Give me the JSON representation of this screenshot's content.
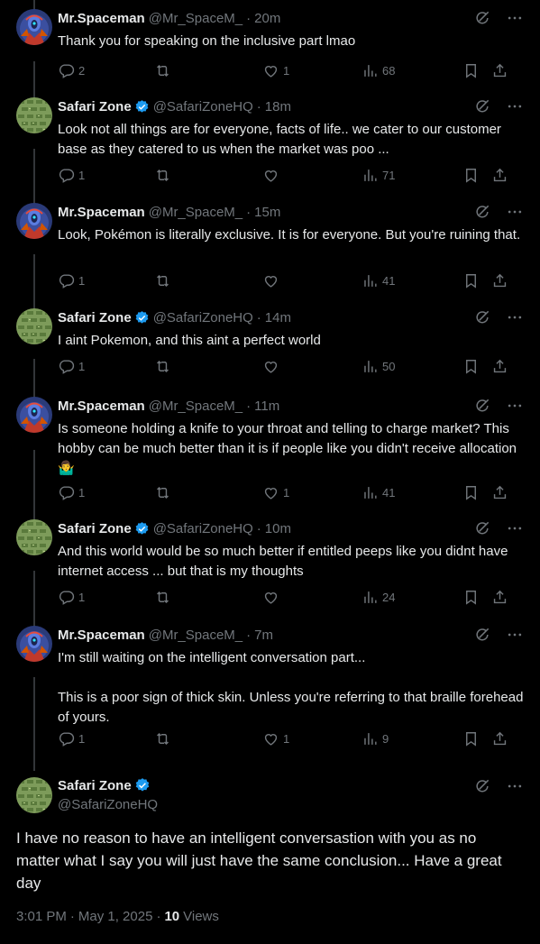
{
  "tweets": [
    {
      "name": "Mr.Spaceman",
      "handle": "@Mr_SpaceM_",
      "time": "20m",
      "verified": false,
      "avatar": "spaceman-avatar",
      "text": "Thank you for speaking on the inclusive part lmao",
      "replies": "2",
      "retweets": "",
      "likes": "1",
      "views": "68"
    },
    {
      "name": "Safari Zone",
      "handle": "@SafariZoneHQ",
      "time": "18m",
      "verified": true,
      "avatar": "safari-avatar",
      "text": "Look not all things are for everyone, facts of life.. we cater to our customer base as they catered to us when the market was poo ...",
      "replies": "1",
      "retweets": "",
      "likes": "",
      "views": "71"
    },
    {
      "name": "Mr.Spaceman",
      "handle": "@Mr_SpaceM_",
      "time": "15m",
      "verified": false,
      "avatar": "spaceman-avatar",
      "text": "Look, Pokémon is literally exclusive. It is for everyone. But you're ruining that.",
      "replies": "1",
      "retweets": "",
      "likes": "",
      "views": "41"
    },
    {
      "name": "Safari Zone",
      "handle": "@SafariZoneHQ",
      "time": "14m",
      "verified": true,
      "avatar": "safari-avatar",
      "text": "I aint Pokemon, and this aint a perfect world",
      "replies": "1",
      "retweets": "",
      "likes": "",
      "views": "50"
    },
    {
      "name": "Mr.Spaceman",
      "handle": "@Mr_SpaceM_",
      "time": "11m",
      "verified": false,
      "avatar": "spaceman-avatar",
      "text": "Is someone holding a knife to your throat and telling to charge market? This hobby can be much better than it is if people like you didn't receive allocation 🤷‍♂️",
      "replies": "1",
      "retweets": "",
      "likes": "1",
      "views": "41"
    },
    {
      "name": "Safari Zone",
      "handle": "@SafariZoneHQ",
      "time": "10m",
      "verified": true,
      "avatar": "safari-avatar",
      "text": "And this world would be so much better if entitled peeps like you didnt have internet access ... but that is my thoughts",
      "replies": "1",
      "retweets": "",
      "likes": "",
      "views": "24"
    },
    {
      "name": "Mr.Spaceman",
      "handle": "@Mr_SpaceM_",
      "time": "7m",
      "verified": false,
      "avatar": "spaceman-avatar",
      "text": "I'm still waiting on the intelligent conversation part...\n\nThis is a poor sign of thick skin. Unless you're referring to that braille forehead of yours.",
      "replies": "1",
      "retweets": "",
      "likes": "1",
      "views": "9"
    }
  ],
  "main_tweet": {
    "name": "Safari Zone",
    "handle": "@SafariZoneHQ",
    "verified": true,
    "avatar": "safari-avatar",
    "text": "I have no reason to have an intelligent conversastion with you as no matter what I say you will just have the same conclusion... Have a great day",
    "time": "3:01 PM",
    "date": "May 1, 2025",
    "views_count": "10",
    "views_label": "Views"
  },
  "colors": {
    "background": "#000000",
    "text": "#e7e9ea",
    "muted": "#71767b",
    "verified": "#1d9bf0",
    "thread_line": "#333639"
  }
}
